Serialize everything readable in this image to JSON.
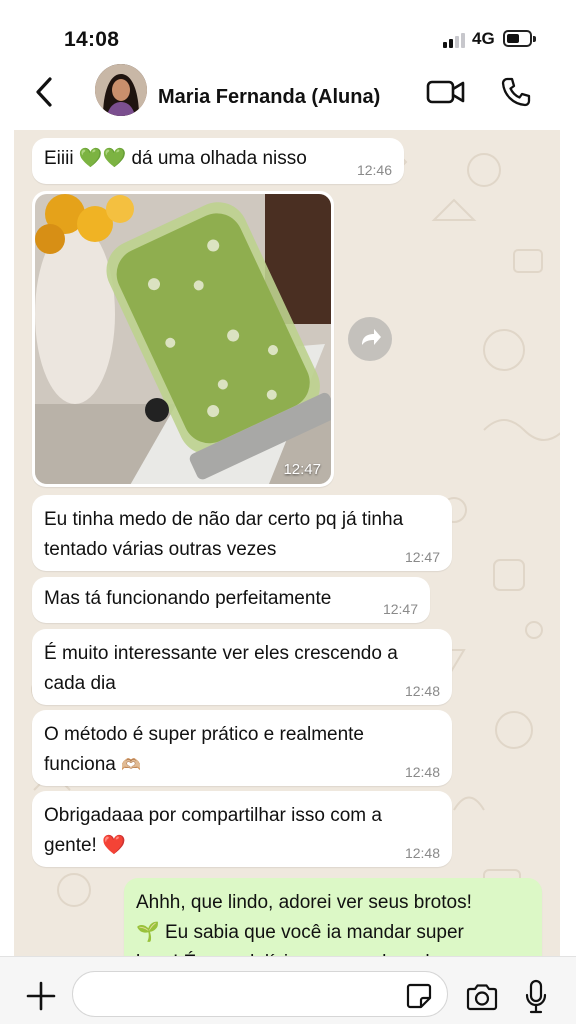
{
  "status_bar": {
    "time": "14:08",
    "network": "4G"
  },
  "header": {
    "contact_name": "Maria Fernanda (Aluna)",
    "back_icon": "chevron-left-icon",
    "video_icon": "video-camera-icon",
    "call_icon": "phone-icon"
  },
  "messages": [
    {
      "id": "m1",
      "direction": "in",
      "text_before": "Eiiii",
      "emoji": "💚💚",
      "text_after": "dá uma olhada nisso",
      "time": "12:46"
    },
    {
      "id": "m2",
      "direction": "in",
      "type": "image",
      "image_alt": "sprouts growing in a glass jar",
      "time": "12:47"
    },
    {
      "id": "m3",
      "direction": "in",
      "text": "Eu tinha medo de não dar certo pq já tinha tentado várias outras vezes",
      "time": "12:47"
    },
    {
      "id": "m4",
      "direction": "in",
      "text": "Mas tá funcionando perfeitamente",
      "time": "12:47"
    },
    {
      "id": "m5",
      "direction": "in",
      "text": "É muito interessante ver eles crescendo a cada dia",
      "time": "12:48"
    },
    {
      "id": "m6",
      "direction": "in",
      "text": "O método é super prático e realmente funciona",
      "emoji": "🫶🏼",
      "time": "12:48"
    },
    {
      "id": "m7",
      "direction": "in",
      "text": "Obrigadaaa por compartilhar isso com a gente!",
      "emoji": "❤️",
      "time": "12:48"
    },
    {
      "id": "m8",
      "direction": "out",
      "line1": "Ahhh, que lindo, adorei ver seus brotos!",
      "emoji": "🌱",
      "line2": "Eu sabia que você ia mandar super",
      "line3": "bem! É uma delícia acompanhar eles"
    }
  ],
  "input": {
    "placeholder": "",
    "value": ""
  },
  "colors": {
    "chat_bg": "#efe8de",
    "incoming": "#ffffff",
    "outgoing": "#dcf8c6",
    "timestamp": "#8a8a8a"
  }
}
